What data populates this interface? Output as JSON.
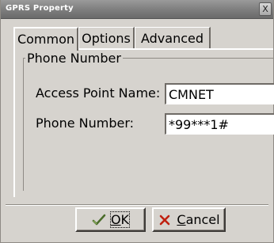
{
  "window": {
    "title": "GPRS Property",
    "close_glyph": "X"
  },
  "tabs": [
    {
      "label": "Common",
      "active": true
    },
    {
      "label": "Options",
      "active": false
    },
    {
      "label": "Advanced",
      "active": false
    }
  ],
  "group": {
    "legend": "Phone Number",
    "fields": [
      {
        "label": "Access Point Name:",
        "value": "CMNET"
      },
      {
        "label": "Phone Number:",
        "value": "*99***1#"
      }
    ]
  },
  "buttons": {
    "ok": {
      "mnemonic": "O",
      "rest": "K",
      "icon": "checkmark-icon"
    },
    "cancel": {
      "mnemonic": "C",
      "rest": "ancel",
      "icon": "x-mark-icon"
    }
  },
  "colors": {
    "face": "#d6d3ce",
    "title_bar": "#7d7d7d",
    "cancel_x": "#c02010",
    "ok_check": "#4a6c2a"
  }
}
